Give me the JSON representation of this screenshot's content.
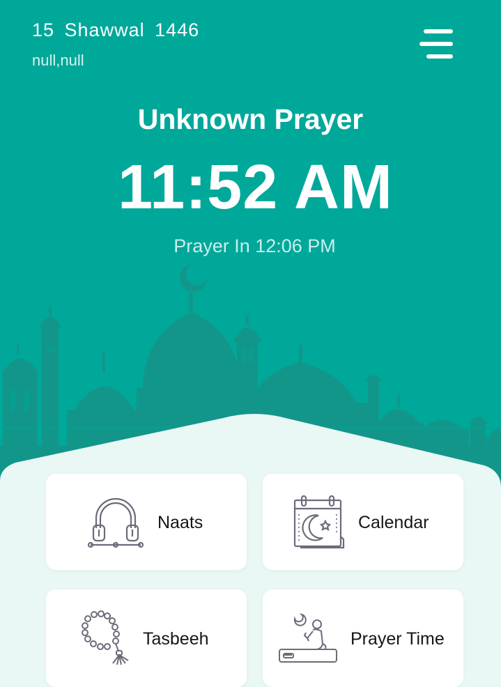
{
  "header": {
    "hijri_date": "15  Shawwal  1446",
    "location": "null,null",
    "prayer_name": "Unknown Prayer",
    "current_time": "11:52 AM",
    "next_prayer_text": "Prayer In 12:06 PM"
  },
  "menu": {
    "icon": "hamburger-menu-icon"
  },
  "cards": [
    {
      "label": "Naats",
      "icon": "headphones-icon"
    },
    {
      "label": "Calendar",
      "icon": "calendar-moon-icon"
    },
    {
      "label": "Tasbeeh",
      "icon": "prayer-beads-icon"
    },
    {
      "label": "Prayer Time",
      "icon": "praying-person-icon"
    }
  ],
  "colors": {
    "primary": "#00a89a",
    "silhouette": "#13968a",
    "background": "#e9f7f5",
    "card": "#ffffff",
    "icon_stroke": "#6b6b7b"
  }
}
